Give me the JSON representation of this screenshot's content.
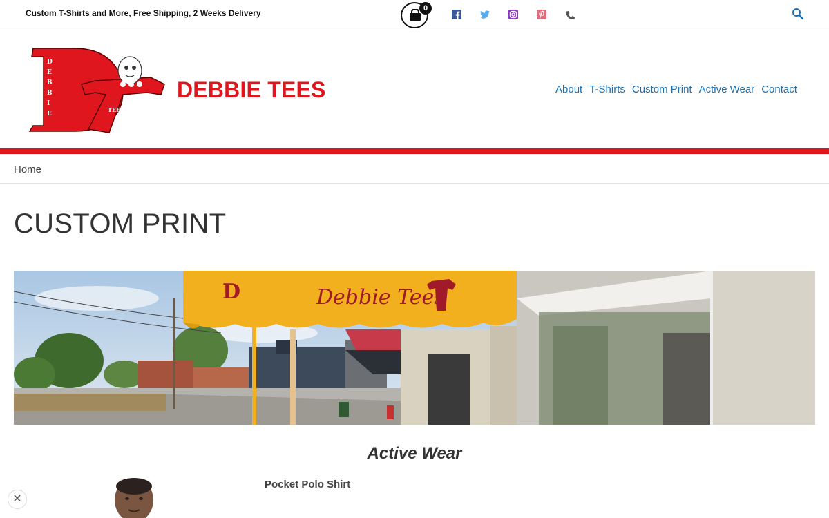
{
  "topbar": {
    "tagline": "Custom T-Shirts and More, Free Shipping, 2 Weeks Delivery",
    "cart_count": "0",
    "social_icons": [
      "facebook-icon",
      "twitter-icon",
      "instagram-icon",
      "pinterest-icon",
      "phone-icon"
    ]
  },
  "header": {
    "brand": "DEBBIE TEES",
    "nav": [
      "About",
      "T-Shirts",
      "Custom Print",
      "Active Wear",
      "Contact"
    ]
  },
  "breadcrumb": "Home",
  "page_title": "CUSTOM PRINT",
  "banner": {
    "awning_text": "Debbie Tees"
  },
  "section_title": "Active Wear",
  "product": {
    "name": "Pocket Polo Shirt"
  },
  "close_label": "✕",
  "colors": {
    "brand_red": "#e0161e",
    "link_blue": "#1a6fb3",
    "awning_yellow": "#f2b01f"
  }
}
